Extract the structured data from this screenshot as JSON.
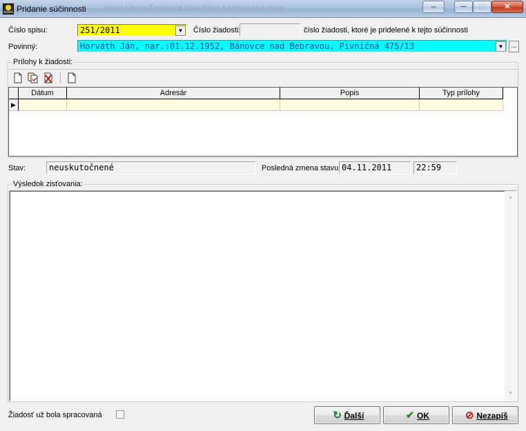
{
  "window": {
    "title": "Pridanie súčinnosti",
    "app_icon_text": "SUDAS",
    "background_menu": "Súbor  Úkony  Evidencia  Stav  Okno  Konfigurácia  Help",
    "buttons": {
      "swap": "⇔",
      "minimize": "─",
      "maximize": "□",
      "close": "✕"
    }
  },
  "form": {
    "spis_label": "Číslo spisu:",
    "spis_value": "251/2011",
    "ziadost_label": "Číslo žiadosti:",
    "ziadost_value": "",
    "ziadost_note": "číslo žiadosti, ktoré je pridelené k tejto súčinnosti",
    "povinny_label": "Povinný:",
    "povinny_value": "Horváth Ján, nar.:01.12.1952, Bánovce nad Bebravou, Pivničná 475/13",
    "browse_label": "...",
    "dropdown_arrow": "▼"
  },
  "attachments": {
    "caption": "Prílohy k žiadosti:",
    "toolbar": [
      "new-doc-icon",
      "copy-doc-icon",
      "delete-doc-icon",
      "blank-doc-icon"
    ],
    "columns": [
      "Dátum",
      "Adresár",
      "Popis",
      "Typ prílohy"
    ],
    "rows": [
      {
        "datum": "",
        "adresar": "",
        "popis": "",
        "typ": ""
      }
    ],
    "row_marker": "▶"
  },
  "status": {
    "stav_label": "Stav:",
    "stav_value": "neuskutočnené",
    "zmena_label": "Posledná zmena stavu:",
    "zmena_date": "04.11.2011",
    "zmena_time": "22:59"
  },
  "result": {
    "caption": "Výsledok zisťovania:",
    "text": "",
    "scroll_up": "▲",
    "scroll_down": "▼"
  },
  "footer": {
    "processed_label": "Žiadosť už bola spracovaná",
    "processed_checked": false,
    "buttons": {
      "next": {
        "icon": "↻",
        "label": "Ďalší"
      },
      "ok": {
        "icon": "✔",
        "label": "OK"
      },
      "cancel": {
        "icon": "⊘",
        "label": "Nezapíš"
      }
    }
  },
  "colors": {
    "spis_highlight": "#ffff00",
    "povinny_highlight": "#00ffff",
    "grid_row": "#fffde0",
    "ok_icon": "#2a8a1a",
    "next_icon": "#1a7a2a",
    "cancel_icon": "#cc1111"
  }
}
